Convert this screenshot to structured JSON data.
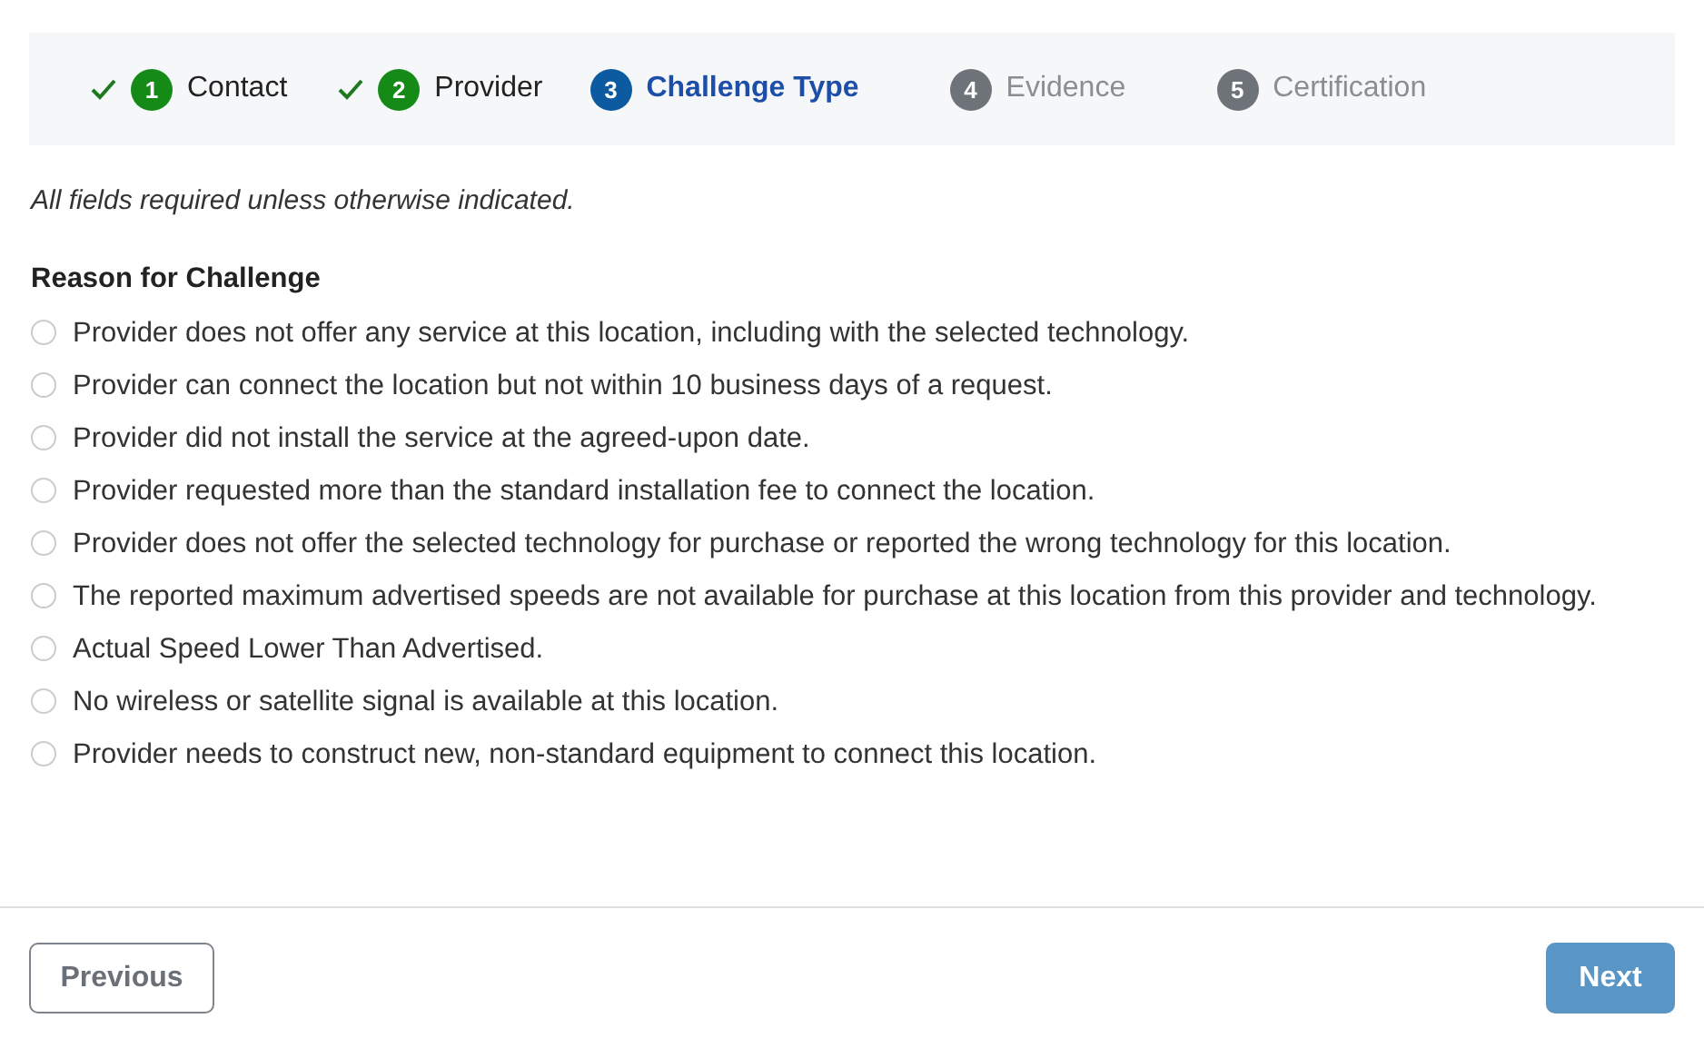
{
  "steps": [
    {
      "number": "1",
      "label": "Contact",
      "complete": true,
      "selected": false
    },
    {
      "number": "2",
      "label": "Provider",
      "complete": true,
      "selected": false
    },
    {
      "number": "3",
      "label": "Challenge Type",
      "complete": false,
      "selected": true
    },
    {
      "number": "4",
      "label": "Evidence",
      "complete": false,
      "selected": false
    },
    {
      "number": "5",
      "label": "Certification",
      "complete": false,
      "selected": false
    }
  ],
  "note": "All fields required unless otherwise indicated.",
  "reason": {
    "legend": "Reason for Challenge",
    "options": [
      {
        "label": "Provider does not offer any service at this location, including with the selected technology.",
        "selected": false
      },
      {
        "label": "Provider can connect the location but not within 10 business days of a request.",
        "selected": false
      },
      {
        "label": "Provider did not install the service at the agreed-upon date.",
        "selected": false
      },
      {
        "label": "Provider requested more than the standard installation fee to connect the location.",
        "selected": false
      },
      {
        "label": "Provider does not offer the selected technology for purchase or reported the wrong technology for this location.",
        "selected": false
      },
      {
        "label": "The reported maximum advertised speeds are not available for purchase at this location from this provider and technology.",
        "selected": false
      },
      {
        "label": "Actual Speed Lower Than Advertised.",
        "selected": false
      },
      {
        "label": "No wireless or satellite signal is available at this location.",
        "selected": false
      },
      {
        "label": "Provider needs to construct new, non-standard equipment to connect this location.",
        "selected": false
      }
    ]
  },
  "buttons": {
    "previous": {
      "label": "Previous"
    },
    "next": {
      "label": "Next",
      "disabled": true
    }
  }
}
